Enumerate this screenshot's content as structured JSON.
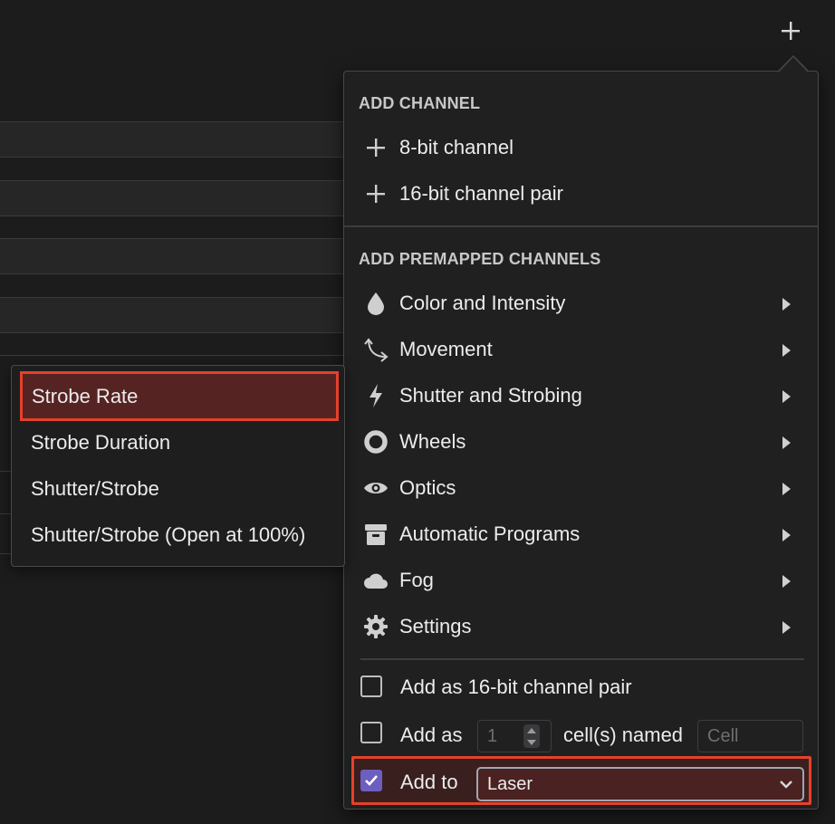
{
  "add_channel": {
    "title": "ADD CHANNEL",
    "items": [
      {
        "label": "8-bit channel",
        "icon": "plus-icon"
      },
      {
        "label": "16-bit channel pair",
        "icon": "plus-icon"
      }
    ]
  },
  "premapped": {
    "title": "ADD PREMAPPED CHANNELS",
    "items": [
      {
        "label": "Color and Intensity",
        "icon": "drop-icon"
      },
      {
        "label": "Movement",
        "icon": "movement-icon"
      },
      {
        "label": "Shutter and Strobing",
        "icon": "lightning-icon"
      },
      {
        "label": "Wheels",
        "icon": "ring-icon"
      },
      {
        "label": "Optics",
        "icon": "eye-icon"
      },
      {
        "label": "Automatic Programs",
        "icon": "box-icon"
      },
      {
        "label": "Fog",
        "icon": "cloud-icon"
      },
      {
        "label": "Settings",
        "icon": "gear-icon"
      }
    ]
  },
  "options": {
    "pair_label": "Add as 16-bit channel pair",
    "cells_prefix": "Add as",
    "cells_count": "1",
    "cells_suffix": "cell(s) named",
    "cell_name_placeholder": "Cell",
    "add_to_label": "Add to",
    "add_to_value": "Laser"
  },
  "submenu": {
    "items": [
      "Strobe Rate",
      "Strobe Duration",
      "Shutter/Strobe",
      "Shutter/Strobe (Open at 100%)"
    ]
  },
  "colors": {
    "accent": "#e5412b",
    "checkbox": "#6d5fc0",
    "menu_bg": "#202021"
  }
}
